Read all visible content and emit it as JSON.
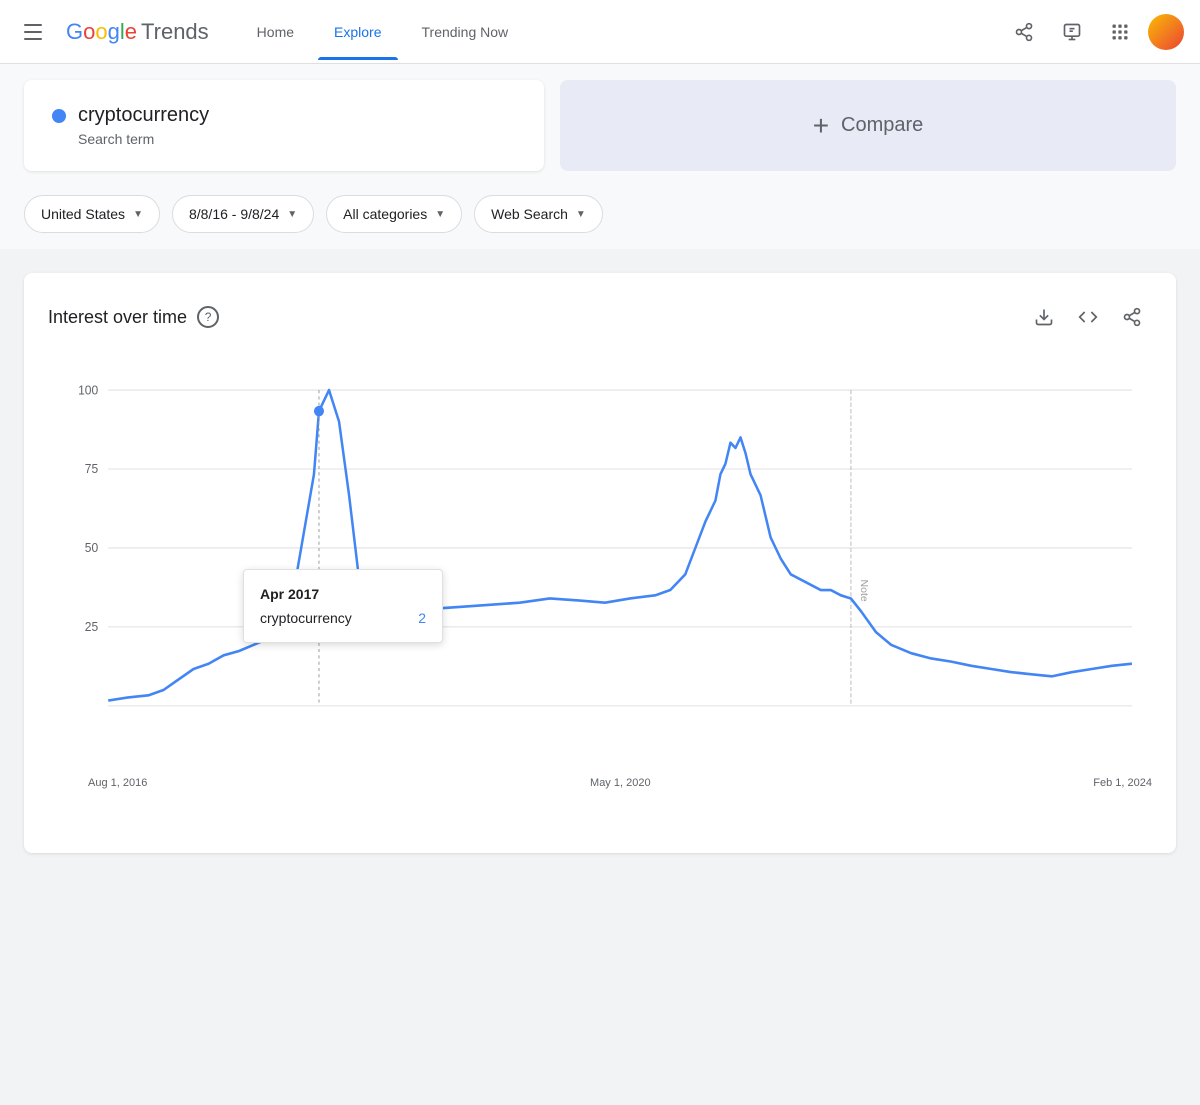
{
  "header": {
    "logo_google": "Google",
    "logo_trends": "Trends",
    "nav": [
      {
        "label": "Home",
        "active": false
      },
      {
        "label": "Explore",
        "active": true
      },
      {
        "label": "Trending Now",
        "active": false
      }
    ],
    "icons": {
      "share": "share-icon",
      "feedback": "feedback-icon",
      "apps": "apps-icon"
    }
  },
  "search_term": {
    "name": "cryptocurrency",
    "type": "Search term",
    "dot_color": "#4285f4"
  },
  "compare": {
    "label": "Compare",
    "plus": "+"
  },
  "filters": [
    {
      "label": "United States",
      "id": "country"
    },
    {
      "label": "8/8/16 - 9/8/24",
      "id": "date-range"
    },
    {
      "label": "All categories",
      "id": "category"
    },
    {
      "label": "Web Search",
      "id": "search-type"
    }
  ],
  "chart": {
    "title": "Interest over time",
    "help_label": "?",
    "tooltip": {
      "date": "Apr 2017",
      "term": "cryptocurrency",
      "value": "2"
    },
    "x_labels": [
      "Aug 1, 2016",
      "May 1, 2020",
      "Feb 1, 2024"
    ],
    "y_labels": [
      "100",
      "75",
      "50",
      "25"
    ],
    "note_label": "Note",
    "actions": {
      "download": "⬇",
      "embed": "<>",
      "share": "share"
    }
  }
}
